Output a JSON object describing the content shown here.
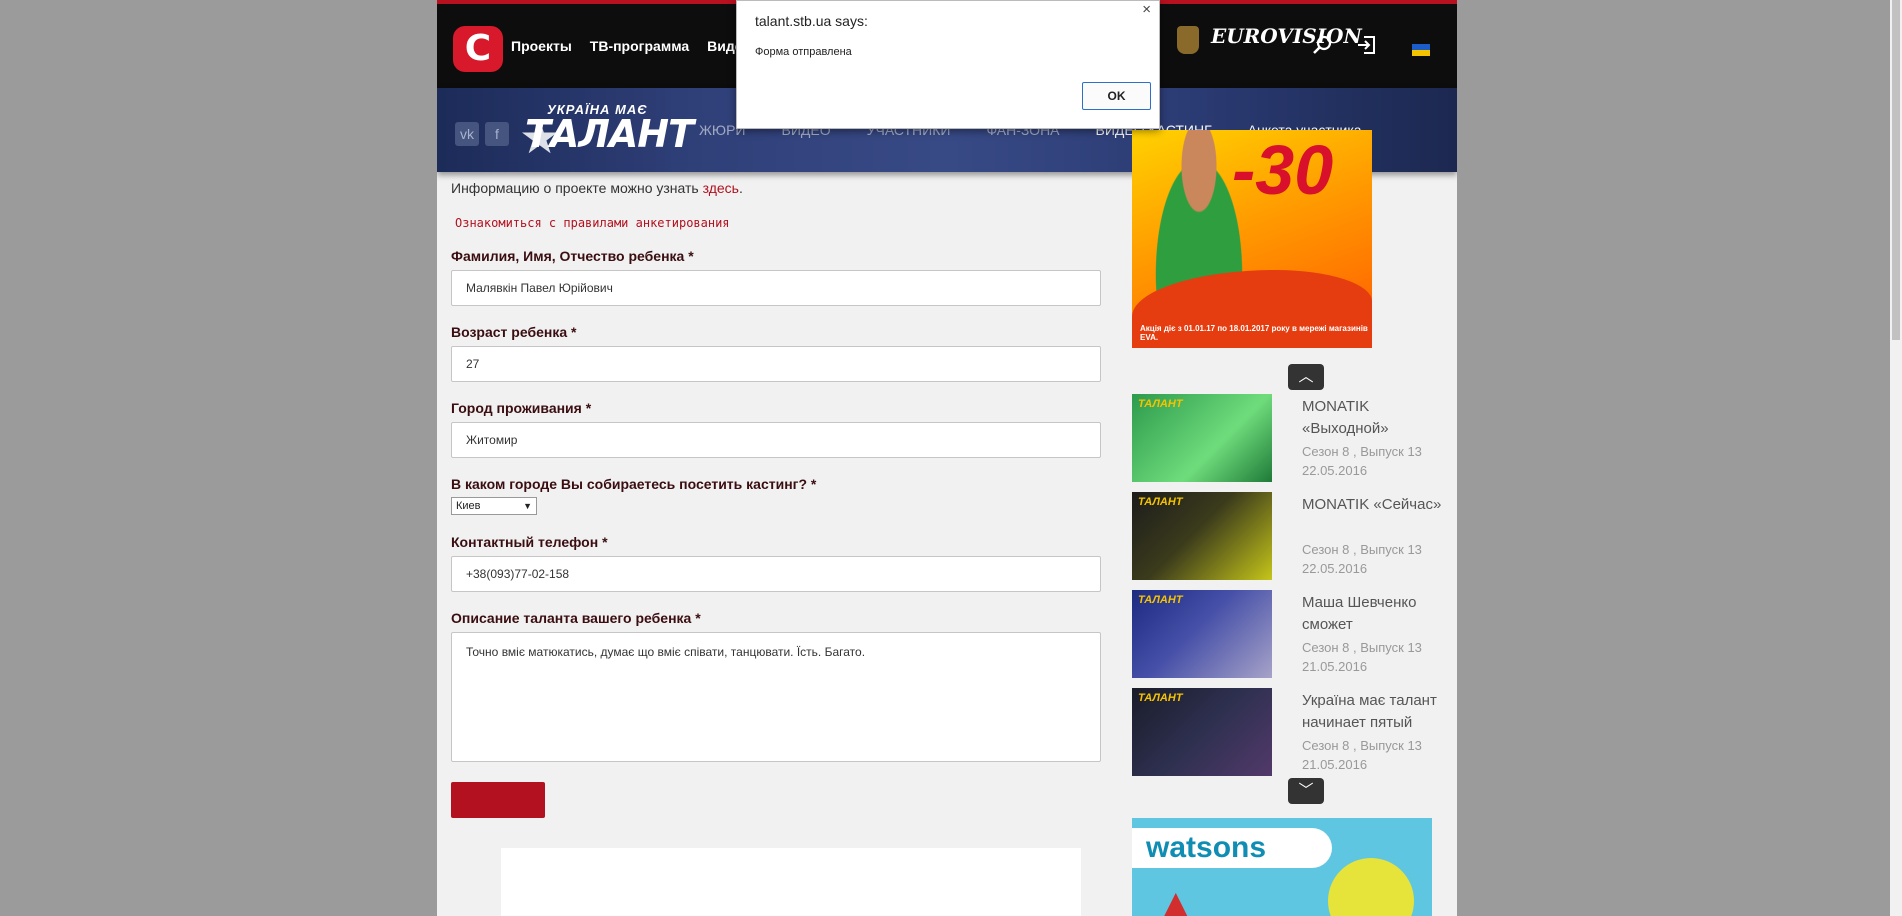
{
  "header": {
    "logo": "С",
    "nav": [
      "Проекты",
      "ТВ-программа",
      "Видео"
    ],
    "eurovision": "EUROVISION",
    "search_icon": "search-icon",
    "login_icon": "login-icon",
    "flag_colors": [
      "#1c5cc8",
      "#f3c500"
    ]
  },
  "banner": {
    "logo_line1": "УКРАЇНА МАЄ",
    "logo_line2": "ТАЛАНТ",
    "nav": [
      "ЖЮРИ",
      "ВИДЕО",
      "УЧАСТНИКИ",
      "ФАН-ЗОНА",
      "ВИДЕО КАСТИНГ",
      "Анкета участника"
    ]
  },
  "dialog": {
    "title": "talant.stb.ua says:",
    "message": "Форма отправлена",
    "ok": "OK",
    "close": "×"
  },
  "form": {
    "info_text": "Информацию о проекте можно узнать ",
    "info_link": "здесь",
    "info_end": ".",
    "rules_link": "Ознакомиться с правилами анкетирования",
    "fields": {
      "name_label": "Фамилия, Имя, Отчество ребенка *",
      "name_value": "Малявкін Павел Юрійович",
      "age_label": "Возраст ребенка *",
      "age_value": "27",
      "city_label": "Город проживания *",
      "city_value": "Житомир",
      "casting_label": "В каком городе Вы собираетесь посетить кастинг? *",
      "casting_value": "Киев",
      "phone_label": "Контактный телефон *",
      "phone_value": "+38(093)77-02-158",
      "talent_label": "Описание таланта вашего ребенка *",
      "talent_value": "Точно вміє матюкатись, думає що вміє співати, танцювати. Їсть. Багато."
    },
    "submit_color": "#b3111f"
  },
  "sidebar": {
    "ad_eva": {
      "discount": "-30",
      "fine_print": "Акція діє з 01.01.17 по 18.01.2017 року в мережі магазинів EVA."
    },
    "videos": [
      {
        "title": "MONATIK «Выходной»",
        "meta": "Сезон 8 , Выпуск 13",
        "date": "22.05.2016"
      },
      {
        "title": "MONATIK «Сейчас»",
        "meta": "Сезон 8 , Выпуск 13",
        "date": "22.05.2016"
      },
      {
        "title": "Маша Шевченко сможет",
        "meta": "Сезон 8 , Выпуск 13",
        "date": "21.05.2016"
      },
      {
        "title": "Україна має талант начинает пятый",
        "meta": "Сезон 8 , Выпуск 13",
        "date": "21.05.2016"
      }
    ],
    "ad_watsons": {
      "brand": "watsons"
    }
  }
}
